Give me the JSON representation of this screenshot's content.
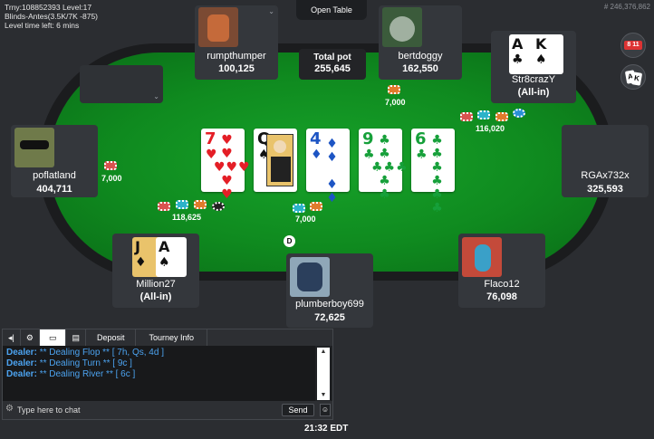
{
  "tournament": {
    "line1": "Trny:108852393 Level:17",
    "line2": "Blinds-Antes(3.5K/7K -875)",
    "line3": "Level time left: 6 mins"
  },
  "table_id": "# 246,376,862",
  "open_table_label": "Open Table",
  "pot": {
    "label": "Total pot",
    "amount": "255,645"
  },
  "community_cards": [
    {
      "rank": "7",
      "suit": "♥",
      "color": "#e41e26"
    },
    {
      "rank": "Q",
      "suit": "♠",
      "color": "#111111"
    },
    {
      "rank": "4",
      "suit": "♦",
      "color": "#1d55c4"
    },
    {
      "rank": "9",
      "suit": "♣",
      "color": "#16a03a"
    },
    {
      "rank": "6",
      "suit": "♣",
      "color": "#16a03a"
    }
  ],
  "players": {
    "rumpthumper": {
      "name": "rumpthumper",
      "stack": "100,125"
    },
    "bertdoggy": {
      "name": "bertdoggy",
      "stack": "162,550"
    },
    "str8crazy": {
      "name": "Str8crazY",
      "stack": "(All-in)",
      "cards": [
        {
          "rank": "A",
          "suit": "♣"
        },
        {
          "rank": "K",
          "suit": "♠"
        }
      ]
    },
    "poflatland": {
      "name": "poflatland",
      "stack": "404,711"
    },
    "rgax732x": {
      "name": "RGAx732x",
      "stack": "325,593"
    },
    "million27": {
      "name": "Million27",
      "stack": "(All-in)",
      "cards": [
        {
          "rank": "J",
          "suit": "♦"
        },
        {
          "rank": "A",
          "suit": "♠"
        }
      ]
    },
    "plumberboy699": {
      "name": "plumberboy699",
      "stack": "72,625"
    },
    "flaco12": {
      "name": "Flaco12",
      "stack": "76,098"
    }
  },
  "bets": {
    "bertdoggy": "7,000",
    "str8crazy": "116,020",
    "poflatland": "7,000",
    "million27": "118,625",
    "plumberboy699": "7,000"
  },
  "dealer_button": "D",
  "chat": {
    "tabs": [
      "Deposit",
      "Tourney Info"
    ],
    "lines": [
      {
        "who": "Dealer:",
        "msg": "** Dealing Flop ** [ 7h, Qs, 4d ]"
      },
      {
        "who": "Dealer:",
        "msg": "** Dealing Turn ** [ 9c ]"
      },
      {
        "who": "Dealer:",
        "msg": "** Dealing River ** [ 6c ]"
      }
    ],
    "placeholder": "Type here to chat",
    "send_label": "Send"
  },
  "top_right_buttons": {
    "button1_text": "8 11"
  },
  "clock": "21:32 EDT"
}
